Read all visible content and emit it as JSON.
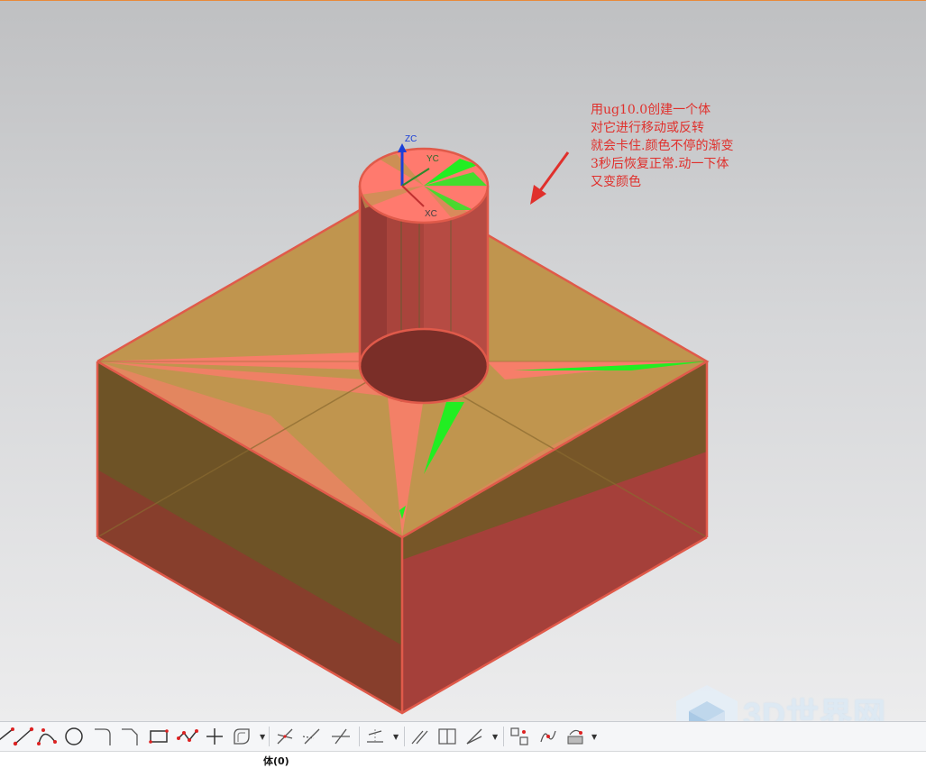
{
  "annotation": {
    "lines": [
      "用ug10.0创建一个体",
      "对它进行移动或反转",
      "就会卡住.颜色不停的渐变",
      "3秒后恢复正常.动一下体",
      "又变颜色"
    ],
    "color": "#e0302c"
  },
  "axes": {
    "z_label": "ZC",
    "y_label": "YC",
    "x_label": "XC"
  },
  "colors": {
    "body_top": "#c0954e",
    "body_edge": "#e05a4a",
    "body_side": "#a5403a",
    "highlight_pink": "#ff7a6e",
    "highlight_green": "#22ee22"
  },
  "toolbar": {
    "groups": [
      {
        "icons": [
          "line-icon",
          "polyline-icon",
          "arc-icon",
          "circle-icon",
          "fillet-icon",
          "chamfer-icon",
          "rectangle-icon",
          "studio-spline-icon",
          "point-icon",
          "offset-curve-icon"
        ]
      },
      {
        "icons": [
          "quick-trim-icon",
          "quick-extend-icon",
          "make-corner-icon"
        ]
      },
      {
        "icons": [
          "derived-line-icon"
        ]
      },
      {
        "icons": [
          "geometric-constraints-icon",
          "display-constraints-icon",
          "rapid-dimension-icon"
        ]
      },
      {
        "icons": [
          "pattern-curve-icon",
          "mirror-curve-icon",
          "project-curve-icon"
        ]
      }
    ]
  },
  "status": {
    "text": "体(0)"
  },
  "watermark": {
    "text": "3D世界网"
  }
}
